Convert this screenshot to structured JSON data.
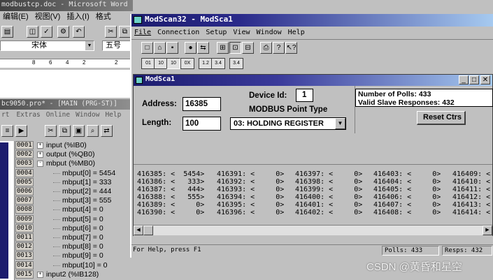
{
  "word": {
    "title": "modbustcp.doc - Microsoft Word",
    "menu": [
      "编辑(E)",
      "视图(V)",
      "插入(I)",
      "格式"
    ],
    "font_name": "宋体",
    "font_size": "五号",
    "ruler": [
      "8",
      "6",
      "4",
      "2",
      "2"
    ]
  },
  "plc": {
    "title": "bc9050.pro* - [MAIN (PRG-ST)]",
    "menu": [
      "rt",
      "Extras",
      "Online",
      "Window",
      "Help"
    ],
    "rows": [
      {
        "num": "0001",
        "text": "input (%IB0)",
        "indent": 1,
        "pm": "+"
      },
      {
        "num": "0002",
        "text": "output (%QB0)",
        "indent": 1,
        "pm": "+"
      },
      {
        "num": "0003",
        "text": "mbput (%MB0)",
        "indent": 1,
        "pm": "-"
      },
      {
        "num": "0004",
        "text": "mbput[0] = 5454",
        "indent": 2,
        "pm": ""
      },
      {
        "num": "0005",
        "text": "mbput[1] = 333",
        "indent": 2,
        "pm": ""
      },
      {
        "num": "0006",
        "text": "mbput[2] = 444",
        "indent": 2,
        "pm": ""
      },
      {
        "num": "0007",
        "text": "mbput[3] = 555",
        "indent": 2,
        "pm": ""
      },
      {
        "num": "0008",
        "text": "mbput[4] = 0",
        "indent": 2,
        "pm": ""
      },
      {
        "num": "0009",
        "text": "mbput[5] = 0",
        "indent": 2,
        "pm": ""
      },
      {
        "num": "0010",
        "text": "mbput[6] = 0",
        "indent": 2,
        "pm": ""
      },
      {
        "num": "0011",
        "text": "mbput[7] = 0",
        "indent": 2,
        "pm": ""
      },
      {
        "num": "0012",
        "text": "mbput[8] = 0",
        "indent": 2,
        "pm": ""
      },
      {
        "num": "0013",
        "text": "mbput[9] = 0",
        "indent": 2,
        "pm": ""
      },
      {
        "num": "0014",
        "text": "mbput[10] = 0",
        "indent": 2,
        "pm": ""
      },
      {
        "num": "0015",
        "text": "input2 (%IB128)",
        "indent": 1,
        "pm": "+"
      }
    ]
  },
  "modscan": {
    "title": "ModScan32 - ModSca1",
    "menu": [
      "File",
      "Connection",
      "Setup",
      "View",
      "Window",
      "Help"
    ],
    "toolbar2": [
      "01",
      "10",
      "10",
      "0X",
      "1.2",
      "3.4",
      "3.4"
    ],
    "child_title": "ModSca1",
    "address_label": "Address:",
    "address_value": "16385",
    "length_label": "Length:",
    "length_value": "100",
    "device_id_label": "Device Id:",
    "device_id_value": "1",
    "point_type_label": "MODBUS Point Type",
    "point_type_value": "03: HOLDING REGISTER",
    "polls_label": "Number of Polls: 433",
    "valid_label": "Valid Slave Responses: 432",
    "reset_label": "Reset Ctrs",
    "data_cols": [
      [
        "416385: <  5454>",
        "416386: <   333>",
        "416387: <   444>",
        "416388: <   555>",
        "416389: <     0>",
        "416390: <     0>"
      ],
      [
        "416391: <     0>",
        "416392: <     0>",
        "416393: <     0>",
        "416394: <     0>",
        "416395: <     0>",
        "416396: <     0>"
      ],
      [
        "416397: <     0>",
        "416398: <     0>",
        "416399: <     0>",
        "416400: <     0>",
        "416401: <     0>",
        "416402: <     0>"
      ],
      [
        "416403: <     0>",
        "416404: <     0>",
        "416405: <     0>",
        "416406: <     0>",
        "416407: <     0>",
        "416408: <     0>"
      ],
      [
        "416409: <",
        "416410: <",
        "416411: <",
        "416412: <",
        "416413: <",
        "416414: <"
      ]
    ],
    "status_help": "For Help, press F1",
    "status_polls": "Polls: 433",
    "status_resps": "Resps: 432"
  },
  "watermark": "CSDN @黄昏和星空",
  "colors": {
    "titlebar_dark": "#1c1c6e",
    "titlebar_light": "#a6caf0",
    "desktop": "#c0c0c0"
  }
}
